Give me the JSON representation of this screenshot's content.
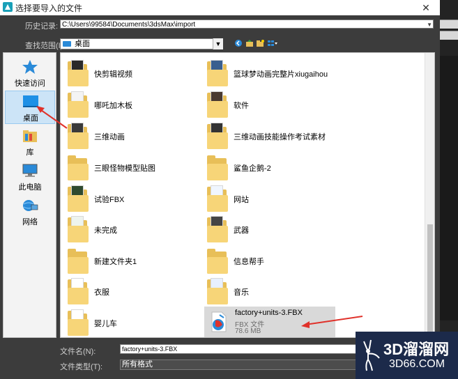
{
  "window": {
    "title": "选择要导入的文件",
    "close_glyph": "✕"
  },
  "history": {
    "label": "历史记录:",
    "value": "C:\\Users\\99584\\Documents\\3dsMax\\import"
  },
  "look_in": {
    "label": "查找范围(I):",
    "value": "桌面"
  },
  "places": [
    {
      "label": "快速访问",
      "icon": "star-icon"
    },
    {
      "label": "桌面",
      "icon": "desktop-icon",
      "selected": true
    },
    {
      "label": "库",
      "icon": "library-icon"
    },
    {
      "label": "此电脑",
      "icon": "computer-icon"
    },
    {
      "label": "网络",
      "icon": "network-icon"
    }
  ],
  "files": {
    "col1": [
      "快剪辑视频",
      "哪吒加木板",
      "三维动画",
      "三眼怪物模型贴图",
      "试验FBX",
      "未完成",
      "新建文件夹1",
      "衣服",
      "婴儿车"
    ],
    "col2": [
      "篮球梦动画完整片xiugaihou",
      "软件",
      "三维动画技能操作考试素材",
      "鲨鱼企鹅-2",
      "网站",
      "武器",
      "信息帮手",
      "音乐"
    ],
    "selected_file": {
      "name": "factory+units-3.FBX",
      "type": "FBX 文件",
      "size": "78.6 MB"
    }
  },
  "file_name": {
    "label": "文件名(N):",
    "value": "factory+units-3.FBX"
  },
  "file_type": {
    "label": "文件类型(T):",
    "value": "所有格式"
  },
  "watermark": {
    "brand": "3D溜溜网",
    "url": "3D66.COM"
  },
  "colors": {
    "accent": "#2a8ad8",
    "arrow": "#e0312a",
    "folder": "#e8bf58"
  }
}
